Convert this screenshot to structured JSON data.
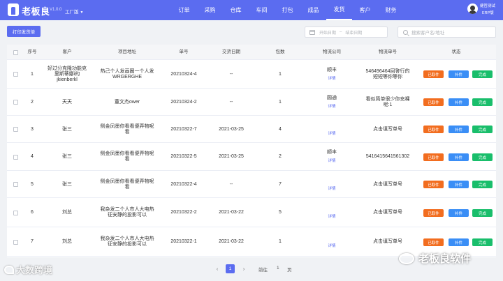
{
  "header": {
    "brand": "老板良",
    "version": "V1.0.0",
    "factory": "工厂版",
    "nav": [
      "订单",
      "采购",
      "仓库",
      "车间",
      "打包",
      "成品",
      "发货",
      "客户",
      "财务"
    ],
    "active_nav": "发货",
    "user_name": "健哲测试",
    "user_role": "ERP版"
  },
  "toolbar": {
    "print_label": "打印发货单",
    "date_start_placeholder": "开始日期",
    "date_sep": "–",
    "date_end_placeholder": "结束日期",
    "search_placeholder": "搜索客户名/地址"
  },
  "table": {
    "columns": [
      "序号",
      "客户",
      "项目地址",
      "单号",
      "交货日期",
      "包数",
      "物流公司",
      "物流单号",
      "状态"
    ],
    "detail_label": "详情",
    "action_labels": {
      "cancel": "已取件",
      "fix": "补件",
      "done": "完成"
    },
    "rows": [
      {
        "no": "1",
        "customer": "好过分克隆功能克里斯蒂娜i的jkienberkl",
        "address": "热己个人发画圈一个人发WRGERGHE",
        "order": "20210324-4",
        "date": "--",
        "packs": "1",
        "carrier": "顺丰",
        "tracking": "546496464回答行的短短等你等你"
      },
      {
        "no": "2",
        "customer": "天天",
        "address": "董文杰ower",
        "order": "20210324-2",
        "date": "--",
        "packs": "1",
        "carrier": "圆通",
        "tracking": "看似简单很少你充裸呢:1"
      },
      {
        "no": "3",
        "customer": "张三",
        "address": "侧金凤墨你看看便弄物呢看",
        "order": "20210322-7",
        "date": "2021-03-25",
        "packs": "4",
        "carrier": "",
        "tracking": "点击填写单号"
      },
      {
        "no": "4",
        "customer": "张三",
        "address": "侧金凤墨你看看便弄物呢看",
        "order": "20210322-5",
        "date": "2021-03-25",
        "packs": "2",
        "carrier": "顺丰",
        "tracking": "5416415641561302"
      },
      {
        "no": "5",
        "customer": "张三",
        "address": "侧金凤墨你看看便弄物呢看",
        "order": "20210322-4",
        "date": "--",
        "packs": "7",
        "carrier": "",
        "tracking": "点击填写单号"
      },
      {
        "no": "6",
        "customer": "刘总",
        "address": "我杂发二个人市人大电热征安静的投影可以",
        "order": "20210322-2",
        "date": "2021-03-22",
        "packs": "5",
        "carrier": "",
        "tracking": "点击填写单号"
      },
      {
        "no": "7",
        "customer": "刘总",
        "address": "我杂发二个人市人大电热征安静的投影可以",
        "order": "20210322-1",
        "date": "2021-03-22",
        "packs": "1",
        "carrier": "",
        "tracking": "点击填写单号"
      }
    ]
  },
  "pagination": {
    "prev": "‹",
    "current": "1",
    "next": "›",
    "goto_label": "前往",
    "goto_value": "1",
    "page_suffix": "页"
  },
  "watermark": {
    "left_text": "大数跨境",
    "right_text": "老板良软件"
  },
  "colors": {
    "primary": "#5b6cf0",
    "cancel": "#f26d1f",
    "fix": "#3a8ef6",
    "done": "#19be6b"
  }
}
